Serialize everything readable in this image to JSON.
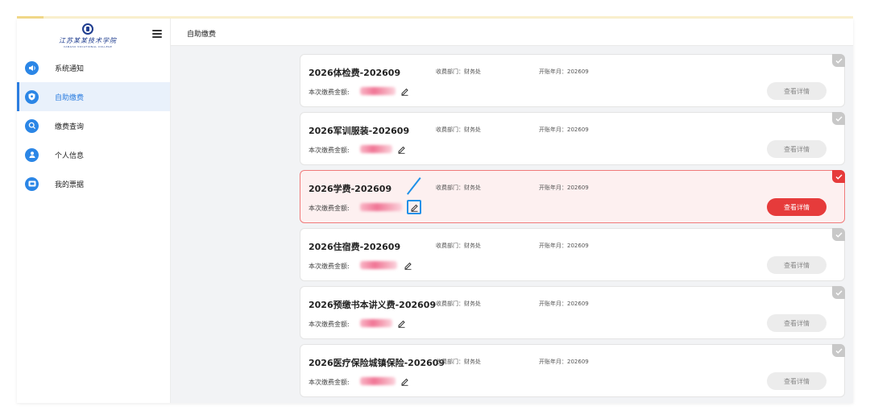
{
  "sidebar": {
    "logo_text": "江苏某某技术学院",
    "logo_sub": "JIANGSU VOCATIONAL COLLEGE",
    "items": [
      {
        "label": "系统通知",
        "icon": "speaker-icon"
      },
      {
        "label": "自助缴费",
        "icon": "shield-icon",
        "active": true
      },
      {
        "label": "缴费查询",
        "icon": "search-icon"
      },
      {
        "label": "个人信息",
        "icon": "user-icon"
      },
      {
        "label": "我的票据",
        "icon": "ticket-icon"
      }
    ]
  },
  "header": {
    "breadcrumb": "自助缴费"
  },
  "fees": [
    {
      "title": "2026体检费-202609",
      "dept": "收费部门：财务处",
      "period": "开账年月：202609",
      "amount_label": "本次缴费金额:",
      "button": "查看详情"
    },
    {
      "title": "2026军训服装-202609",
      "dept": "收费部门：财务处",
      "period": "开账年月：202609",
      "amount_label": "本次缴费金额:",
      "button": "查看详情"
    },
    {
      "title": "2026学费-202609",
      "dept": "收费部门：财务处",
      "period": "开账年月：202609",
      "amount_label": "本次缴费金额:",
      "button": "查看详情",
      "selected": true
    },
    {
      "title": "2026住宿费-202609",
      "dept": "收费部门：财务处",
      "period": "开账年月：202609",
      "amount_label": "本次缴费金额:",
      "button": "查看详情"
    },
    {
      "title": "2026预缴书本讲义费-202609",
      "dept": "收费部门：财务处",
      "period": "开账年月：202609",
      "amount_label": "本次缴费金额:",
      "button": "查看详情"
    },
    {
      "title": "2026医疗保险城镇保险-202609",
      "dept": "收费部门：财务处",
      "period": "开账年月：202609",
      "amount_label": "本次缴费金额:",
      "button": "查看详情"
    }
  ],
  "colors": {
    "accent": "#2b7de0",
    "danger": "#e63b3b",
    "highlight": "#1e90e8"
  }
}
